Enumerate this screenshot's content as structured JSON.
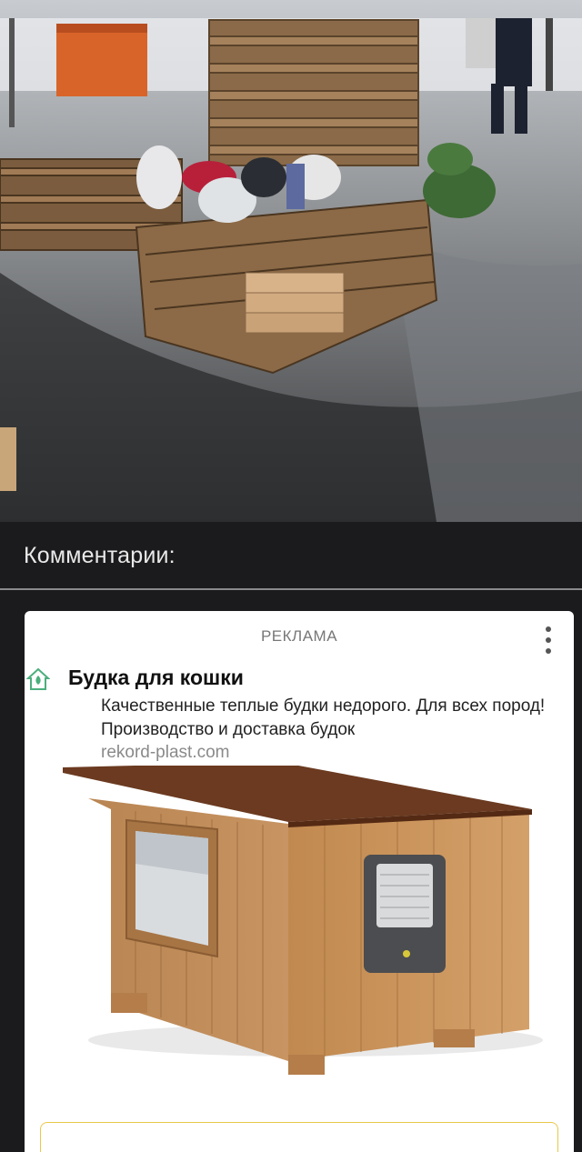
{
  "comments": {
    "title": "Комментарии:"
  },
  "ad": {
    "label": "РЕКЛАМА",
    "title": "Будка для кошки",
    "description": "Качественные теплые будки недорого. Для всех пород! Производство и доставка будок",
    "domain": "rekord-plast.com",
    "icons": {
      "brand": "house-logo-icon",
      "menu": "more-vertical-icon"
    },
    "colors": {
      "accent": "#4caf7d",
      "border": "#e9c84a"
    }
  }
}
